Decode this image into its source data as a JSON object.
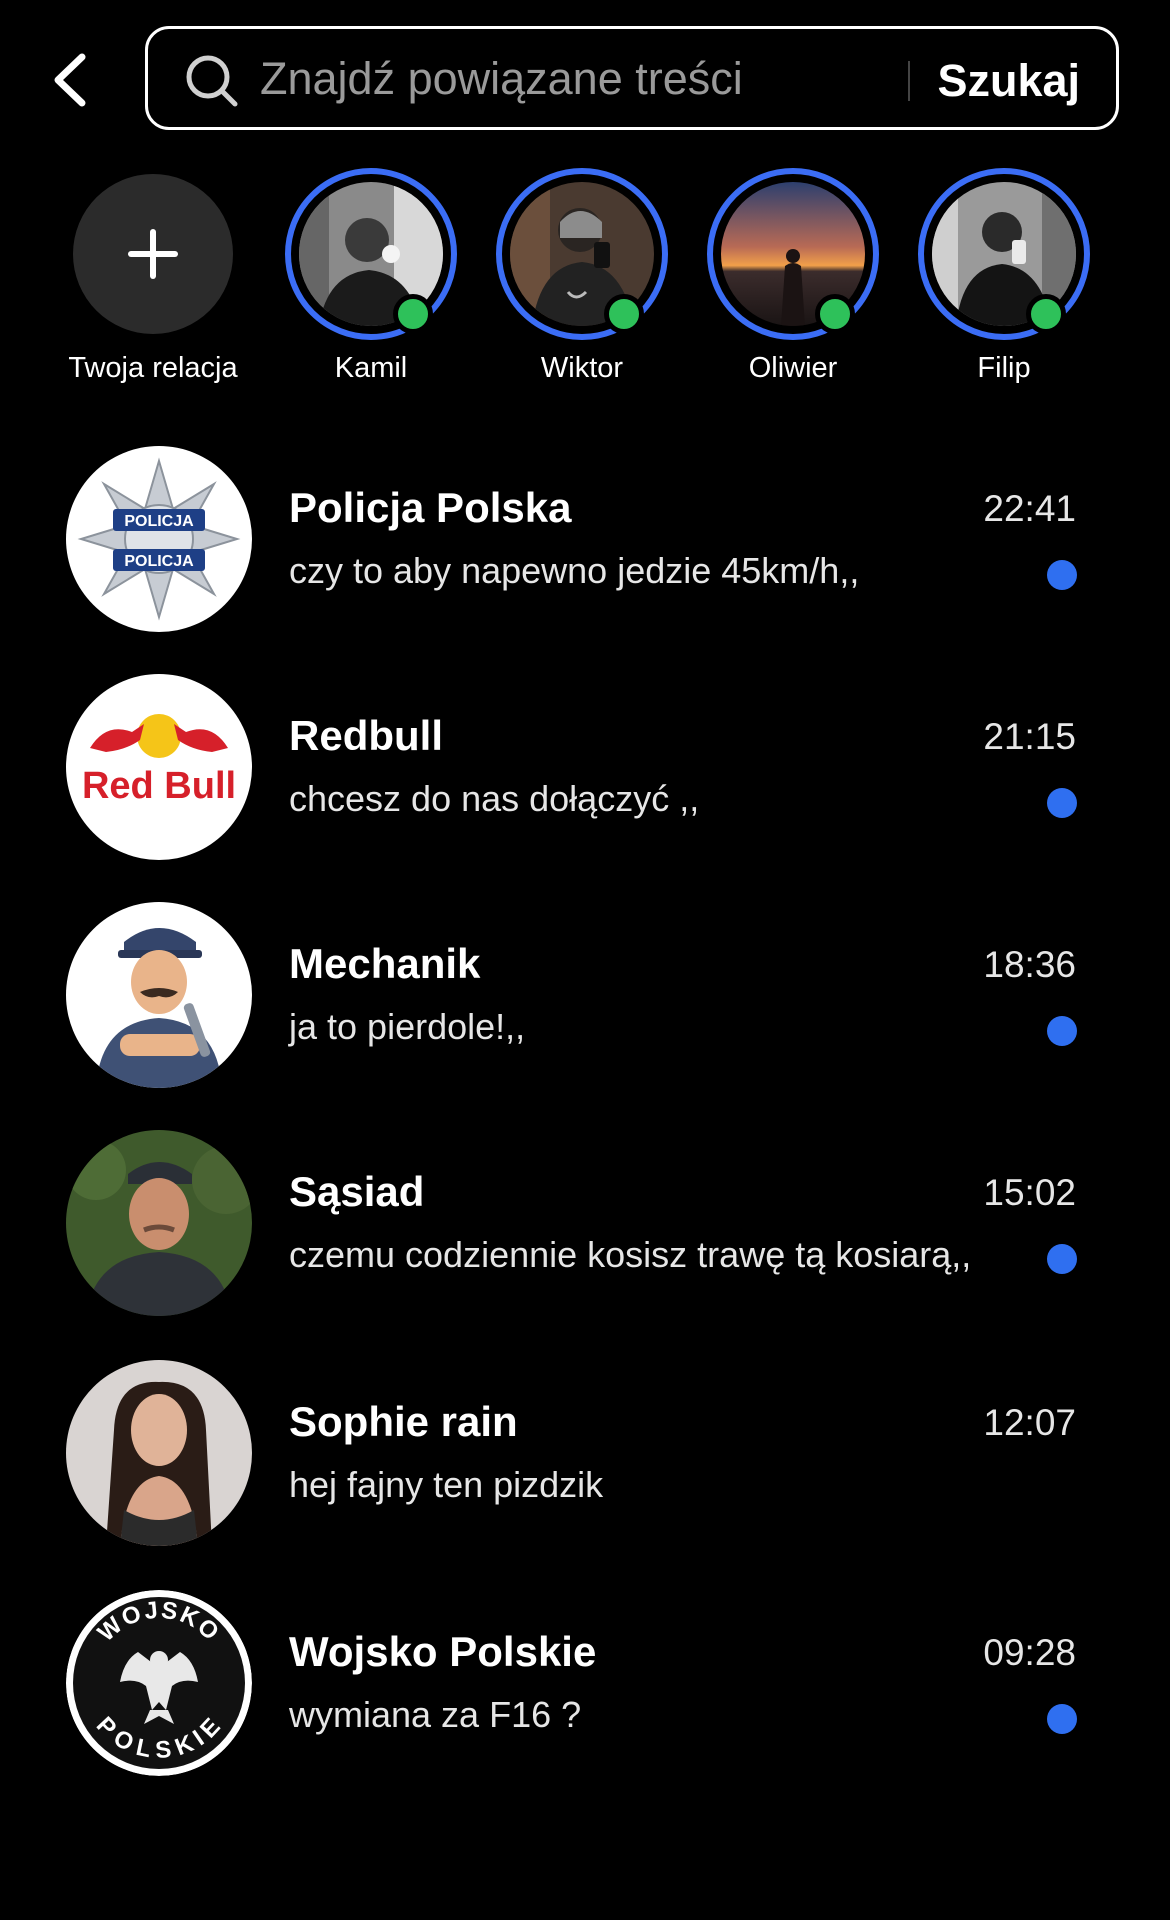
{
  "search": {
    "placeholder": "Znajdź powiązane treści",
    "submit_label": "Szukaj"
  },
  "stories": {
    "add_label": "Twoja relacja",
    "items": [
      {
        "name": "Kamil",
        "online": true
      },
      {
        "name": "Wiktor",
        "online": true
      },
      {
        "name": "Oliwier",
        "online": true
      },
      {
        "name": "Filip",
        "online": true
      }
    ]
  },
  "conversations": [
    {
      "name": "Policja Polska",
      "message": "czy to aby napewno jedzie 45km/h,,",
      "time": "22:41",
      "unread": true
    },
    {
      "name": "Redbull",
      "message": "chcesz do nas dołączyć ,,",
      "time": "21:15",
      "unread": true
    },
    {
      "name": "Mechanik",
      "message": "ja to pierdole!,,",
      "time": "18:36",
      "unread": true
    },
    {
      "name": "Sąsiad",
      "message": "czemu codziennie kosisz trawę tą kosiarą,,",
      "time": "15:02",
      "unread": true
    },
    {
      "name": "Sophie rain",
      "message": "hej fajny ten pizdzik",
      "time": "12:07",
      "unread": false
    },
    {
      "name": "Wojsko Polskie",
      "message": "wymiana za F16 ?",
      "time": "09:28",
      "unread": true
    }
  ],
  "logos": {
    "policja_text": "POLICJA",
    "redbull_text": "Red Bull",
    "wojsko_top": "WOJSKO",
    "wojsko_bottom": "POLSKIE"
  },
  "colors": {
    "background": "#000000",
    "story_ring": "#3b6df5",
    "online": "#2ec15a",
    "unread": "#2f6ff0",
    "redbull_red": "#d6202a",
    "redbull_yellow": "#f5c518"
  },
  "icons": {
    "back": "chevron-left-icon",
    "search": "search-icon",
    "add_story": "plus-icon"
  }
}
